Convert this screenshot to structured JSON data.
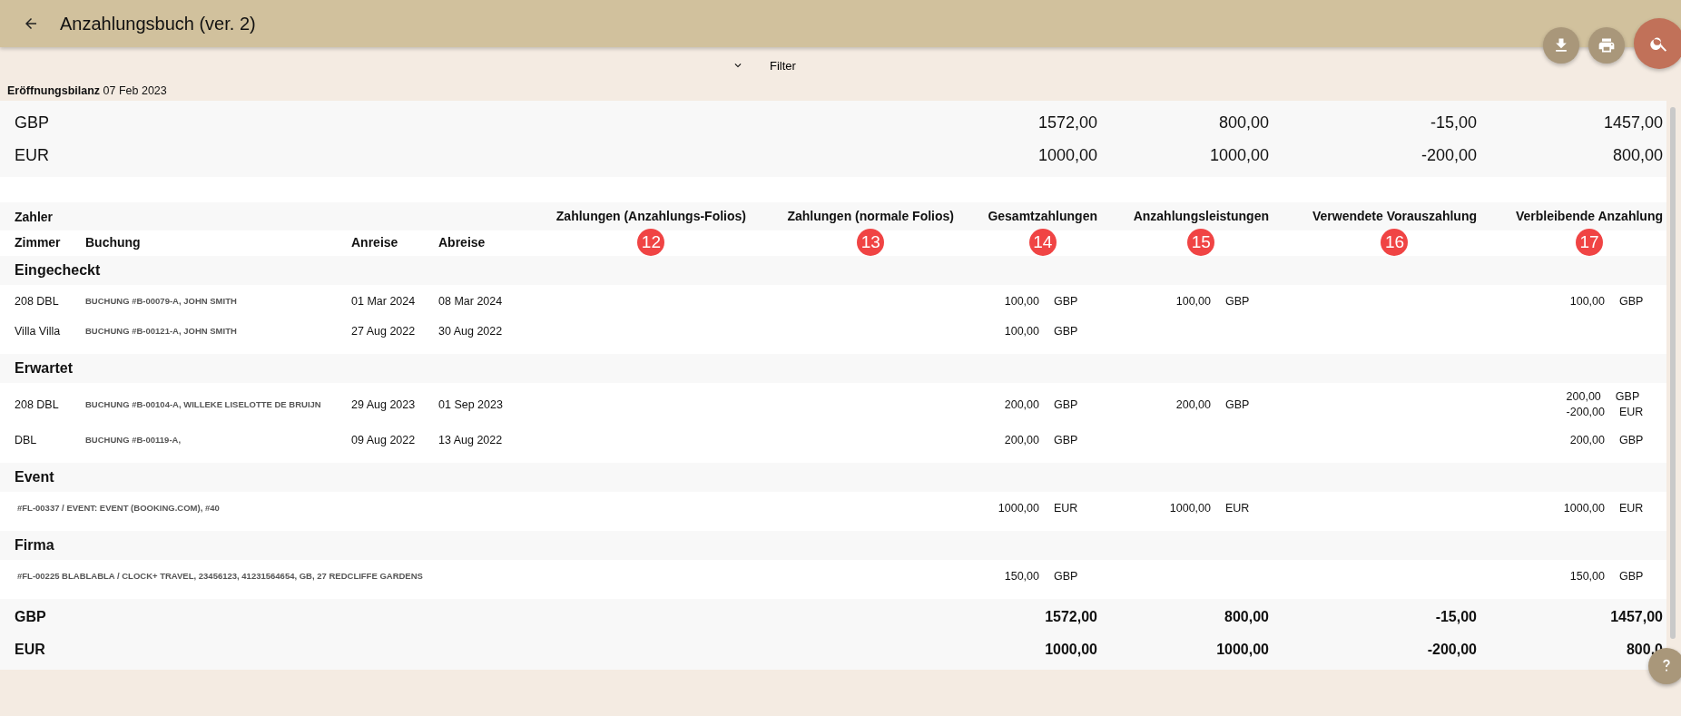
{
  "title": "Anzahlungsbuch (ver. 2)",
  "filter": {
    "label": "Filter",
    "expanded": false
  },
  "opening_balance": {
    "label": "Eröffnungsbilanz",
    "date": "07 Feb 2023",
    "rows": [
      {
        "currency": "GBP",
        "values": [
          "1572,00",
          "800,00",
          "-15,00",
          "1457,00"
        ]
      },
      {
        "currency": "EUR",
        "values": [
          "1000,00",
          "1000,00",
          "-200,00",
          "800,00"
        ]
      }
    ]
  },
  "table": {
    "payer_label": "Zahler",
    "row_columns": [
      "Zimmer",
      "Buchung",
      "Anreise",
      "Abreise"
    ],
    "amount_columns": [
      {
        "label": "Zahlungen (Anzahlungs-Folios)",
        "badge": "12"
      },
      {
        "label": "Zahlungen (normale Folios)",
        "badge": "13"
      },
      {
        "label": "Gesamtzahlungen",
        "badge": "14"
      },
      {
        "label": "Anzahlungsleistungen",
        "badge": "15"
      },
      {
        "label": "Verwendete Vorauszahlung",
        "badge": "16"
      },
      {
        "label": "Verbleibende Anzahlung",
        "badge": "17"
      }
    ],
    "groups": [
      {
        "title": "Eingecheckt",
        "rows": [
          {
            "kind": "booking",
            "room": "208 DBL",
            "booking": "BUCHUNG #B-00079-A, JOHN SMITH",
            "arrival": "01 Mar 2024",
            "departure": "08 Mar 2024",
            "total_payments": [
              {
                "amount": "100,00",
                "currency": "GBP"
              }
            ],
            "deposit_services": [
              {
                "amount": "100,00",
                "currency": "GBP"
              }
            ],
            "remaining_deposit": [
              {
                "amount": "100,00",
                "currency": "GBP"
              }
            ]
          },
          {
            "kind": "booking",
            "room": "Villa Villa",
            "booking": "BUCHUNG #B-00121-A, JOHN SMITH",
            "arrival": "27 Aug 2022",
            "departure": "30 Aug 2022",
            "total_payments": [
              {
                "amount": "100,00",
                "currency": "GBP"
              }
            ]
          }
        ]
      },
      {
        "title": "Erwartet",
        "rows": [
          {
            "kind": "booking",
            "room": "208 DBL",
            "booking": "BUCHUNG #B-00104-A, WILLEKE LISELOTTE DE BRUIJN",
            "arrival": "29 Aug 2023",
            "departure": "01 Sep 2023",
            "total_payments": [
              {
                "amount": "200,00",
                "currency": "GBP"
              }
            ],
            "deposit_services": [
              {
                "amount": "200,00",
                "currency": "GBP"
              }
            ],
            "remaining_deposit": [
              {
                "amount": "200,00",
                "currency": "GBP"
              },
              {
                "amount": "-200,00",
                "currency": "EUR"
              }
            ]
          },
          {
            "kind": "booking",
            "room": "DBL",
            "booking": "BUCHUNG #B-00119-A,",
            "arrival": "09 Aug 2022",
            "departure": "13 Aug 2022",
            "total_payments": [
              {
                "amount": "200,00",
                "currency": "GBP"
              }
            ],
            "remaining_deposit": [
              {
                "amount": "200,00",
                "currency": "GBP"
              }
            ]
          }
        ]
      },
      {
        "title": "Event",
        "rows": [
          {
            "kind": "folio",
            "booking": "#FL-00337 / EVENT: EVENT (BOOKING.COM), #40",
            "total_payments": [
              {
                "amount": "1000,00",
                "currency": "EUR"
              }
            ],
            "deposit_services": [
              {
                "amount": "1000,00",
                "currency": "EUR"
              }
            ],
            "remaining_deposit": [
              {
                "amount": "1000,00",
                "currency": "EUR"
              }
            ]
          }
        ]
      },
      {
        "title": "Firma",
        "rows": [
          {
            "kind": "folio",
            "booking": "#FL-00225 BLABLABLA / CLOCK+ TRAVEL, 23456123, 41231564654, GB, 27 REDCLIFFE GARDENS",
            "total_payments": [
              {
                "amount": "150,00",
                "currency": "GBP"
              }
            ],
            "remaining_deposit": [
              {
                "amount": "150,00",
                "currency": "GBP"
              }
            ]
          }
        ]
      }
    ],
    "totals": [
      {
        "currency": "GBP",
        "values": [
          "1572,00",
          "800,00",
          "-15,00",
          "1457,00"
        ]
      },
      {
        "currency": "EUR",
        "values": [
          "1000,00",
          "1000,00",
          "-200,00",
          "800,0"
        ]
      }
    ]
  }
}
